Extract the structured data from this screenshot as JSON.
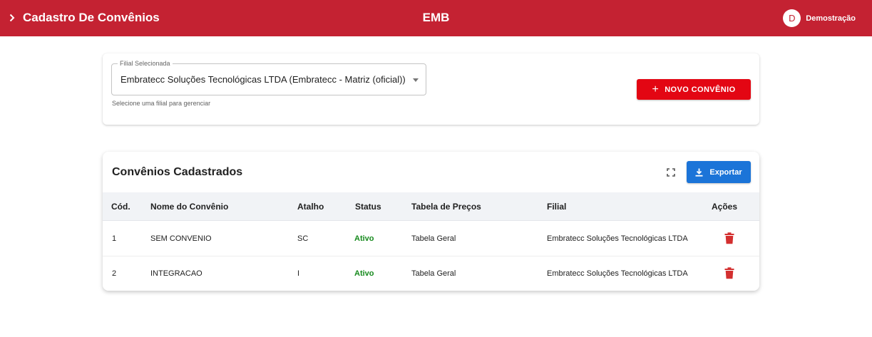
{
  "header": {
    "title": "Cadastro De Convênios",
    "center": "EMB",
    "user_initial": "D",
    "user_name": "Demostração"
  },
  "filter": {
    "legend": "Filial Selecionada",
    "selected": "Embratecc Soluções Tecnológicas LTDA (Embratecc - Matriz (oficial))",
    "helper": "Selecione uma filial para gerenciar",
    "new_button": "NOVO CONVÊNIO"
  },
  "list": {
    "title": "Convênios Cadastrados",
    "export_button": "Exportar",
    "columns": [
      "Cód.",
      "Nome do Convênio",
      "Atalho",
      "Status",
      "Tabela de Preços",
      "Filial",
      "Ações"
    ],
    "rows": [
      {
        "code": "1",
        "name": "SEM CONVENIO",
        "shortcut": "SC",
        "status": "Ativo",
        "price_table": "Tabela Geral",
        "branch": "Embratecc Soluções Tecnológicas LTDA"
      },
      {
        "code": "2",
        "name": "INTEGRACAO",
        "shortcut": "I",
        "status": "Ativo",
        "price_table": "Tabela Geral",
        "branch": "Embratecc Soluções Tecnológicas LTDA"
      }
    ]
  },
  "colors": {
    "header": "#c42232",
    "new_button": "#e30613",
    "export_button": "#1b74d8",
    "status_active": "#168a1d",
    "delete": "#d32f2f"
  },
  "icons": [
    "chevron-right-icon",
    "arrow-drop-down-icon",
    "plus-icon",
    "fullscreen-icon",
    "download-icon",
    "delete-icon"
  ]
}
